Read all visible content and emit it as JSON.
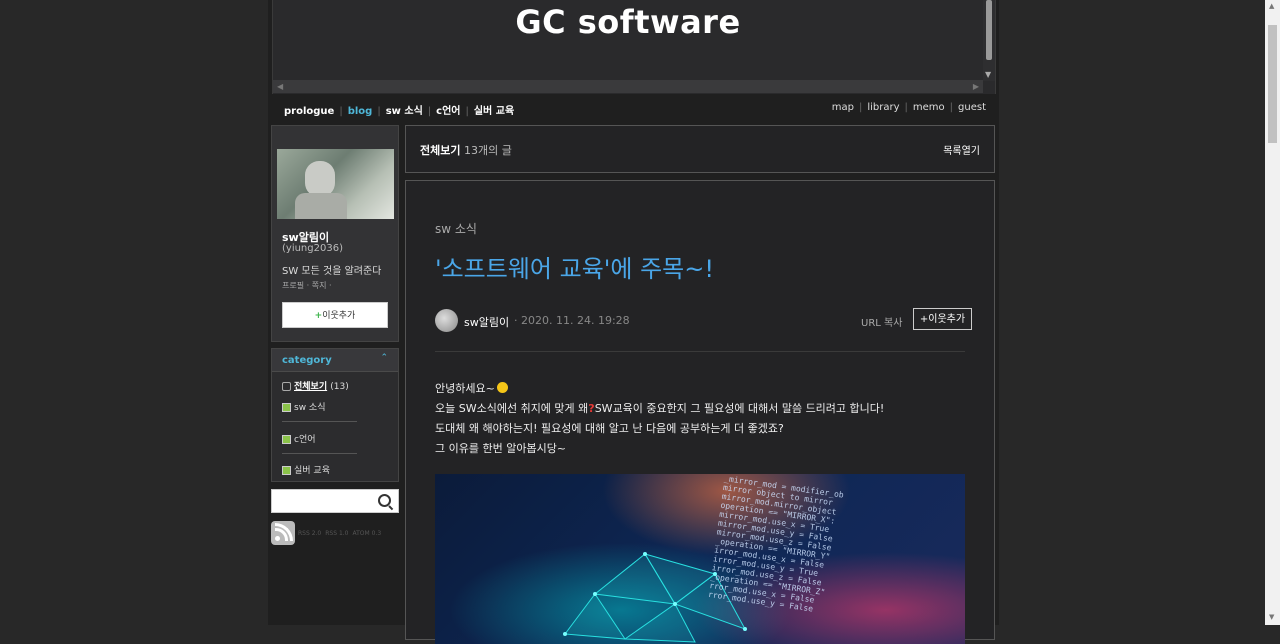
{
  "header": {
    "blog_title": "GC software"
  },
  "nav": {
    "left": [
      "prologue",
      "blog",
      "sw 소식",
      "c언어",
      "실버 교육"
    ],
    "right": [
      "map",
      "library",
      "memo",
      "guest"
    ]
  },
  "profile": {
    "name": "sw알림이",
    "id": "(yiung2036)",
    "description": "SW 모든 것을 알려준다",
    "links": [
      "프로필",
      "쪽지"
    ],
    "neighbor_button": "이웃추가"
  },
  "category": {
    "title": "category",
    "all_label": "전체보기",
    "all_count": "(13)",
    "items": [
      "sw 소식",
      "c언어",
      "실버 교육"
    ]
  },
  "search": {
    "placeholder": ""
  },
  "rss": {
    "links": [
      "RSS 2.0",
      "RSS 1.0",
      "ATOM 0.3"
    ]
  },
  "post_list": {
    "title": "전체보기",
    "count": "13개의 글",
    "toggle": "목록열기"
  },
  "post": {
    "category": "sw 소식",
    "title": "'소프트웨어 교육'에 주목~!",
    "author": "sw알림이",
    "date": "· 2020. 11. 24. 19:28",
    "url_copy": "URL 복사",
    "add_neighbor": "+이웃추가",
    "body": {
      "line1": "안녕하세요~",
      "line2_a": "오늘 SW소식에선 취지에 맞게 왜",
      "line2_b": "SW교육이  중요한지 그 필요성에 대해서 말씀 드리려고 합니다!",
      "line3": "도대체 왜 해야하는지! 필요성에 대해 알고 난 다음에 공부하는게 더 좋겠죠?",
      "line4": "그 이유를 한번 알아봅시당~"
    },
    "image_code": "_mirror_mod = modifier_ob\nmirror object to mirror\nmirror_mod.mirror_object\noperation == \"MIRROR_X\":\nmirror_mod.use_x = True\nmirror_mod.use_y = False\nmirror_mod.use_z = False\n_operation == \"MIRROR_Y\"\nirror_mod.use_x = False\nirror_mod.use_y = True\nirror_mod.use_z = False\n_operation == \"MIRROR_Z\"\nrror_mod.use_x = False\nrror_mod.use_y = False"
  }
}
